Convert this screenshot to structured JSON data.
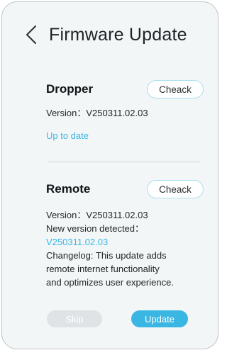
{
  "header": {
    "title": "Firmware Update",
    "back_icon": "chevron-left-icon"
  },
  "dropper": {
    "name": "Dropper",
    "check_label": "Cheack",
    "version": "Version：V250311.02.03",
    "status": "Up to date"
  },
  "remote": {
    "name": "Remote",
    "check_label": "Cheack",
    "version": "Version：V250311.02.03",
    "new_version_label": "New version detected：",
    "new_version": "V250311.02.03",
    "changelog_lines": [
      "Changelog: This update adds",
      "remote internet functionality",
      "and optimizes user experience."
    ]
  },
  "actions": {
    "skip_label": "Skip",
    "update_label": "Update"
  },
  "colors": {
    "accent": "#3ab6e3",
    "background": "#f3f6f7",
    "skip_bg": "#dfe3e6"
  }
}
